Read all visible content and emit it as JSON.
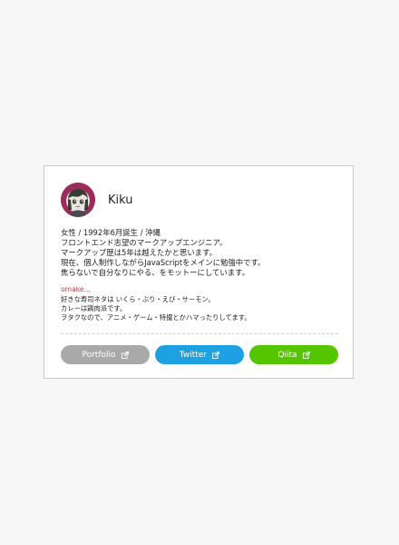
{
  "profile": {
    "name": "Kiku"
  },
  "bio": {
    "lines": [
      "女性 / 1992年6月誕生 / 沖縄",
      "フロントエンド志望のマークアップエンジニア。",
      "マークアップ歴は5年は越えたかと思います。",
      "現在、個人制作しながらJavaScriptをメインに勉強中です。",
      "焦らないで自分なりにやる、をモットーにしています。"
    ]
  },
  "omake": {
    "title": "omake...",
    "lines": [
      "好きな寿司ネタは いくら・ぶり・えび・サーモン。",
      "カレーは鶏肉派です。",
      "ヲタクなので、アニメ・ゲーム・特撮とかハマったりしてます。"
    ]
  },
  "links": [
    {
      "label": "Portfolio",
      "color": "#a9a9a9",
      "icon": "external-link-icon"
    },
    {
      "label": "Twitter",
      "color": "#1da1e2",
      "icon": "external-link-icon"
    },
    {
      "label": "Qiita",
      "color": "#55c500",
      "icon": "external-link-icon"
    }
  ],
  "colors": {
    "background": "#f6f6f6",
    "card": "#ffffff",
    "omake_title": "#c44141",
    "avatar_ring": "#9c2a5a"
  }
}
